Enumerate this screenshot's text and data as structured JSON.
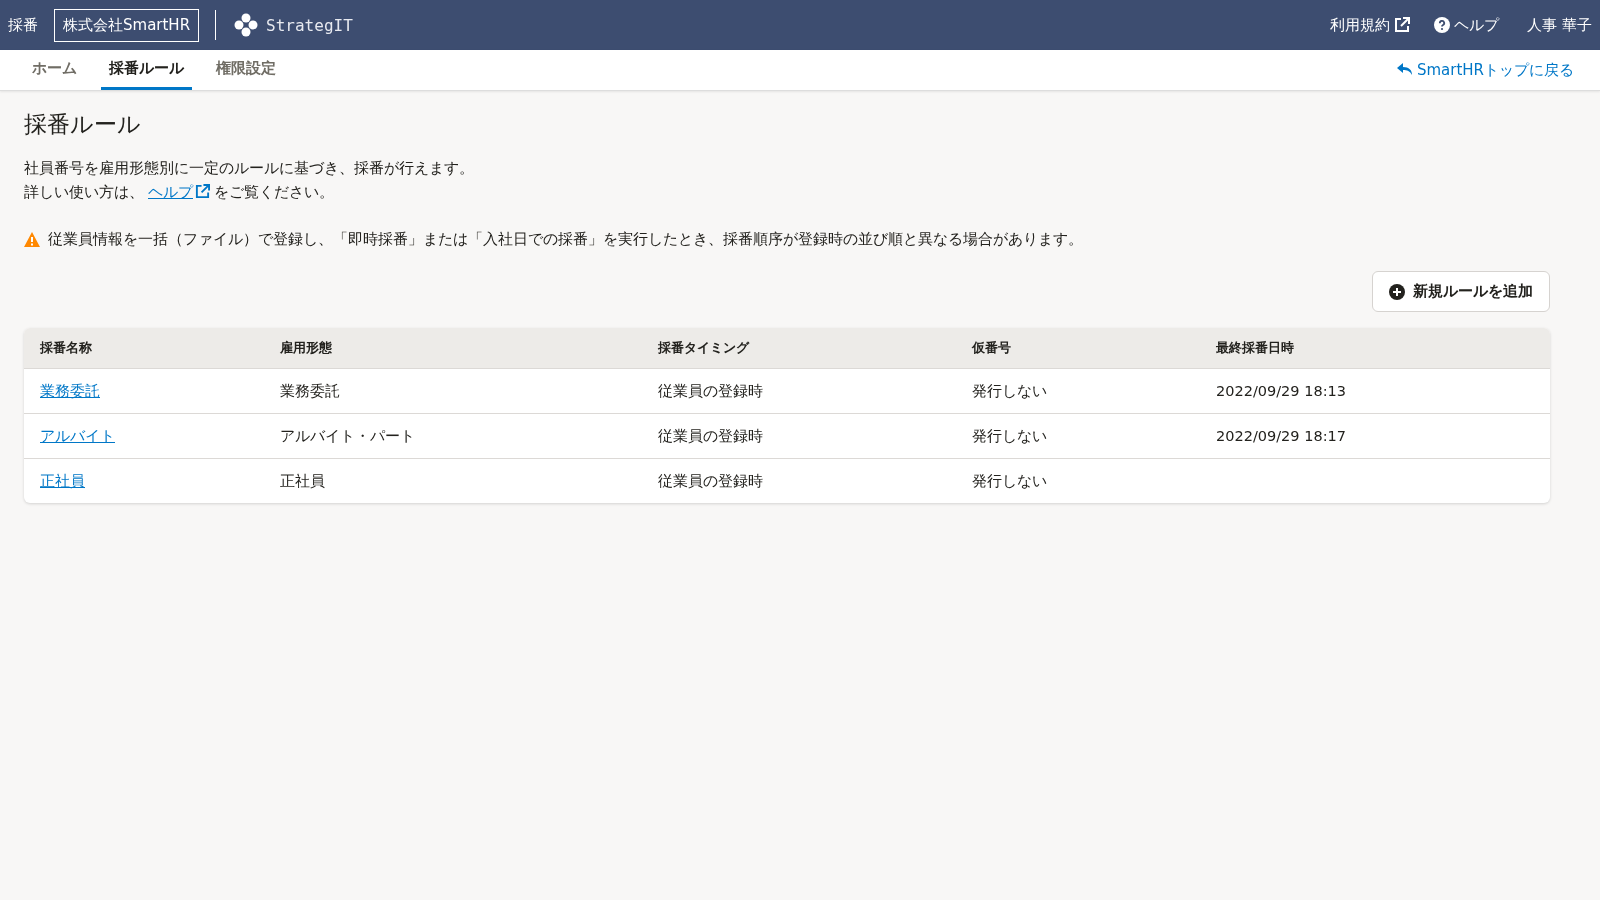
{
  "header": {
    "app_name": "採番",
    "company": "株式会社SmartHR",
    "logo_text": "StrategIT",
    "links": [
      {
        "label": "利用規約",
        "kind": "external"
      },
      {
        "label": "ヘルプ",
        "kind": "help"
      }
    ],
    "user": "人事 華子"
  },
  "tabs": [
    {
      "label": "ホーム",
      "selected": false
    },
    {
      "label": "採番ルール",
      "selected": true
    },
    {
      "label": "権限設定",
      "selected": false
    }
  ],
  "back_link": "SmartHRトップに戻る",
  "page": {
    "title": "採番ルール",
    "description": "社員番号を雇用形態別に一定のルールに基づき、採番が行えます。",
    "help_prefix": "詳しい使い方は、",
    "help_link": "ヘルプ",
    "help_suffix": "をご覧ください。",
    "warning": "従業員情報を一括（ファイル）で登録し、「即時採番」または「入社日での採番」を実行したとき、採番順序が登録時の並び順と異なる場合があります。"
  },
  "add_button": "新規ルールを追加",
  "table": {
    "columns": [
      "採番名称",
      "雇用形態",
      "採番タイミング",
      "仮番号",
      "最終採番日時"
    ],
    "rows": [
      [
        "業務委託",
        "業務委託",
        "従業員の登録時",
        "発行しない",
        "2022/09/29 18:13"
      ],
      [
        "アルバイト",
        "アルバイト・パート",
        "従業員の登録時",
        "発行しない",
        "2022/09/29 18:17"
      ],
      [
        "正社員",
        "正社員",
        "従業員の登録時",
        "発行しない",
        ""
      ]
    ]
  }
}
